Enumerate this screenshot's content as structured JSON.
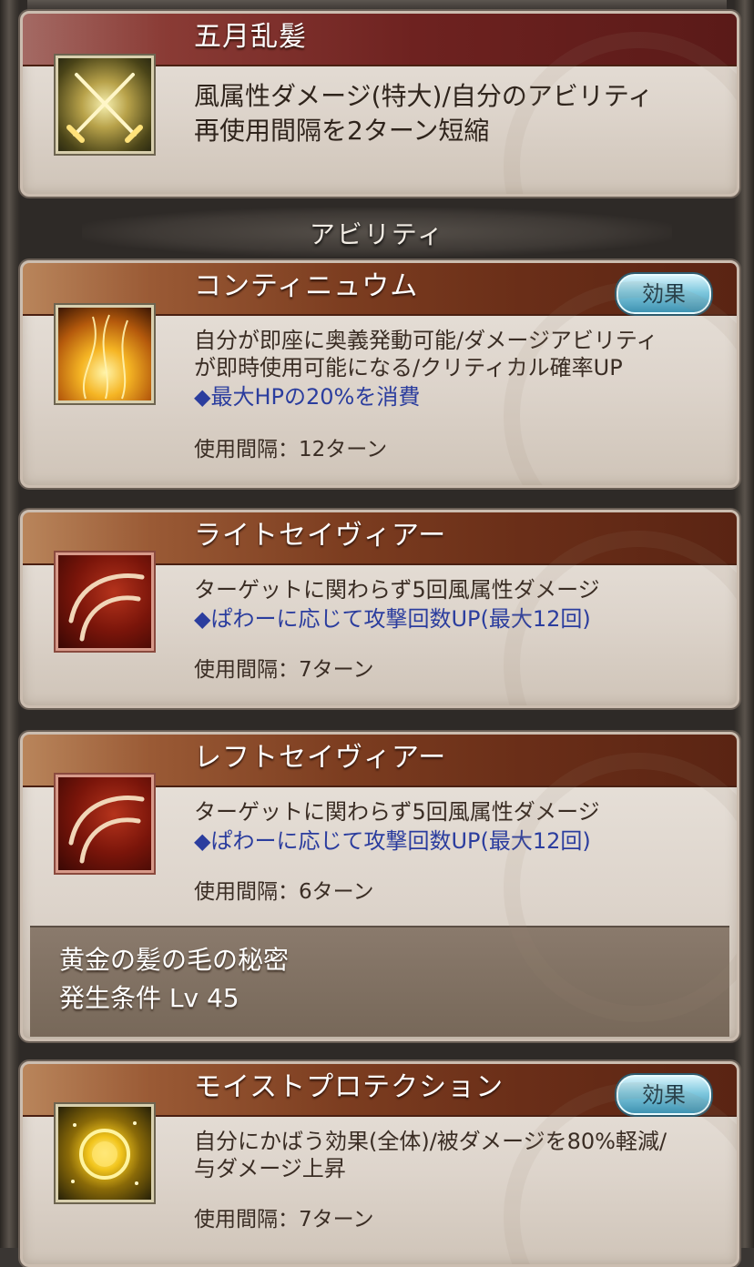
{
  "ougi": {
    "name": "五月乱髪",
    "desc_line1": "風属性ダメージ(特大)/自分のアビリティ",
    "desc_line2": "再使用間隔を2ターン短縮"
  },
  "section_title": "アビリティ",
  "effect_badge_label": "効果",
  "abilities": [
    {
      "name": "コンティニュウム",
      "desc_line1": "自分が即座に奥義発動可能/ダメージアビリティ",
      "desc_line2": "が即時使用可能になる/クリティカル確率UP",
      "note": "◆最大HPの20%を消費",
      "cooldown": "使用間隔：12ターン",
      "has_effect_badge": true
    },
    {
      "name": "ライトセイヴィアー",
      "desc_line1": "ターゲットに関わらず5回風属性ダメージ",
      "note": "◆ぱわーに応じて攻撃回数UP(最大12回)",
      "cooldown": "使用間隔：7ターン",
      "has_effect_badge": false
    },
    {
      "name": "レフトセイヴィアー",
      "desc_line1": "ターゲットに関わらず5回風属性ダメージ",
      "note": "◆ぱわーに応じて攻撃回数UP(最大12回)",
      "cooldown": "使用間隔：6ターン",
      "has_effect_badge": false,
      "support": {
        "name": "黄金の髪の毛の秘密",
        "condition": "発生条件 Lv 45"
      }
    },
    {
      "name": "モイストプロテクション",
      "desc_line1": "自分にかばう効果(全体)/被ダメージを80%軽減/",
      "desc_line2": "与ダメージ上昇",
      "cooldown": "使用間隔：7ターン",
      "has_effect_badge": true
    }
  ],
  "icons": [
    "crossed-swords-icon",
    "golden-flames-icon",
    "crimson-slash-icon",
    "crimson-slash-icon",
    "golden-orb-icon"
  ]
}
